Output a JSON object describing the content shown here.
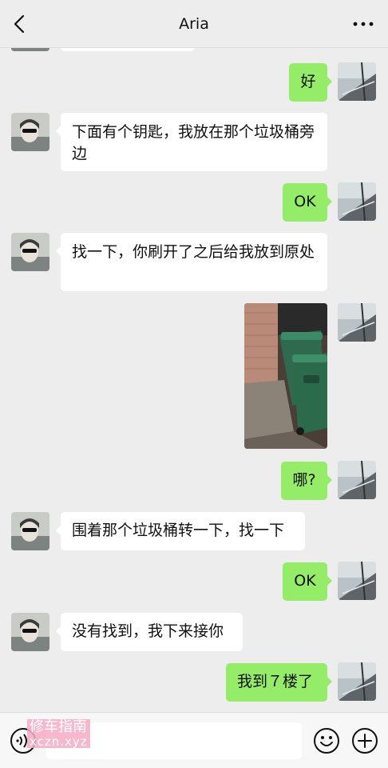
{
  "header": {
    "title": "Aria"
  },
  "messages": [
    {
      "from": "me",
      "type": "text",
      "text": "好"
    },
    {
      "from": "aria",
      "type": "text",
      "text": "下面有个钥匙，我放在那个垃圾桶旁边"
    },
    {
      "from": "me",
      "type": "text",
      "text": "OK"
    },
    {
      "from": "aria",
      "type": "text",
      "text": "找一下，你刷开了之后给我放到原处"
    },
    {
      "from": "me",
      "type": "image",
      "description_icon": "trash-bins-photo"
    },
    {
      "from": "me",
      "type": "text",
      "text": "哪?"
    },
    {
      "from": "aria",
      "type": "text",
      "text": "围着那个垃圾桶转一下，找一下"
    },
    {
      "from": "me",
      "type": "text",
      "text": "OK"
    },
    {
      "from": "aria",
      "type": "text",
      "text": "没有找到，我下来接你"
    },
    {
      "from": "me",
      "type": "text",
      "text": "我到７楼了"
    }
  ],
  "input": {
    "placeholder": ""
  },
  "watermark": {
    "line1": "修车指南",
    "line2": "xczn.xyz"
  },
  "colors": {
    "background": "#ededed",
    "outgoing_bubble": "#95ec69",
    "incoming_bubble": "#ffffff"
  }
}
